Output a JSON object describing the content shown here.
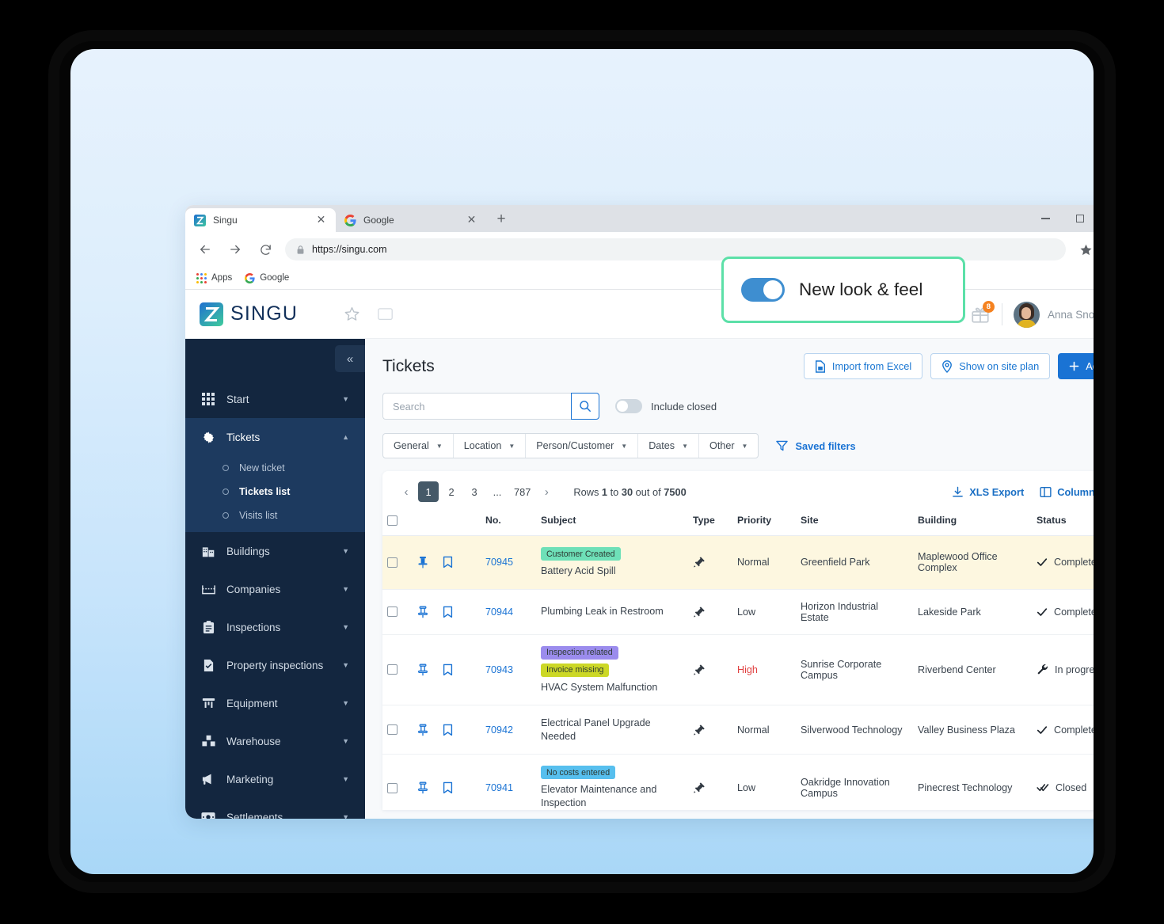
{
  "browser": {
    "tabs": [
      {
        "title": "Singu",
        "favicon": "singu-logo-icon",
        "active": true
      },
      {
        "title": "Google",
        "favicon": "google-g-icon",
        "active": false
      }
    ],
    "new_tab_label": "+",
    "url": "https://singu.com",
    "bookmarks": [
      {
        "label": "Apps",
        "icon": "apps-grid-icon"
      },
      {
        "label": "Google",
        "icon": "google-g-icon"
      }
    ],
    "window_controls": [
      "minimize",
      "maximize",
      "close"
    ]
  },
  "header": {
    "brand": "SINGU",
    "icons": [
      "star-outline-icon",
      "note-icon"
    ],
    "promo": {
      "label": "New look & feel",
      "toggle_on": true,
      "highlight_color": "#5ce0a8",
      "switch_color": "#3e8ed0"
    },
    "gift": {
      "icon": "gift-icon",
      "badge": "8",
      "badge_color": "#f58220"
    },
    "user": {
      "name": "Anna Snow",
      "avatar": "user-avatar",
      "chevron": "chevron-down-icon"
    }
  },
  "sidebar": {
    "collapse_icon": "double-chevron-left-icon",
    "items": [
      {
        "label": "Start",
        "icon": "grid-icon",
        "active": false,
        "expandable": true
      },
      {
        "label": "Tickets",
        "icon": "gear-icon",
        "active": true,
        "expandable": true,
        "expanded": true
      },
      {
        "label": "Buildings",
        "icon": "building-icon",
        "active": false,
        "expandable": true
      },
      {
        "label": "Companies",
        "icon": "companies-icon",
        "active": false,
        "expandable": true
      },
      {
        "label": "Inspections",
        "icon": "clipboard-icon",
        "active": false,
        "expandable": true
      },
      {
        "label": "Property inspections",
        "icon": "document-check-icon",
        "active": false,
        "expandable": true
      },
      {
        "label": "Equipment",
        "icon": "equipment-icon",
        "active": false,
        "expandable": true
      },
      {
        "label": "Warehouse",
        "icon": "warehouse-icon",
        "active": false,
        "expandable": true
      },
      {
        "label": "Marketing",
        "icon": "megaphone-icon",
        "active": false,
        "expandable": true
      },
      {
        "label": "Settlements",
        "icon": "money-icon",
        "active": false,
        "expandable": true
      }
    ],
    "tickets_sub": [
      {
        "label": "New ticket",
        "current": false
      },
      {
        "label": "Tickets list",
        "current": true
      },
      {
        "label": "Visits list",
        "current": false
      }
    ]
  },
  "main": {
    "title": "Tickets",
    "actions": [
      {
        "label": "Import from Excel",
        "icon": "excel-file-icon",
        "style": "outline"
      },
      {
        "label": "Show on site plan",
        "icon": "map-pin-icon",
        "style": "outline"
      },
      {
        "label": "Add",
        "icon": "plus-icon",
        "style": "primary"
      }
    ],
    "search": {
      "value": "",
      "placeholder": "Search",
      "button_icon": "search-icon"
    },
    "include_closed": {
      "label": "Include closed",
      "on": false
    },
    "filters": [
      {
        "label": "General"
      },
      {
        "label": "Location"
      },
      {
        "label": "Person/Customer"
      },
      {
        "label": "Dates"
      },
      {
        "label": "Other"
      }
    ],
    "saved_filters": {
      "label": "Saved filters",
      "icon": "filter-icon"
    },
    "pagination": {
      "prev_icon": "chevron-left-icon",
      "next_icon": "chevron-right-icon",
      "pages": [
        "1",
        "2",
        "3",
        "...",
        "787"
      ],
      "current": "1",
      "rows_prefix": "Rows",
      "rows_from": "1",
      "rows_mid": "to",
      "rows_to": "30",
      "rows_suffix": "out of",
      "rows_total": "7500"
    },
    "table_tools": [
      {
        "label": "XLS Export",
        "icon": "download-icon"
      },
      {
        "label": "Columns",
        "icon": "columns-icon"
      }
    ],
    "table": {
      "columns": [
        "",
        "",
        "No.",
        "Subject",
        "Type",
        "Priority",
        "Site",
        "Building",
        "Status",
        ""
      ],
      "rows": [
        {
          "no": "70945",
          "badges": [
            {
              "text": "Customer Created",
              "color": "#6ee0b8"
            }
          ],
          "subject": "Battery Acid Spill",
          "type_icon": "wrench-hammer-icon",
          "priority": "Normal",
          "priority_level": "normal",
          "site": "Greenfield Park",
          "building": "Maplewood Office Complex",
          "status": "Completed",
          "status_icon": "check-icon",
          "pinned": true,
          "highlight": true
        },
        {
          "no": "70944",
          "badges": [],
          "subject": "Plumbing Leak in Restroom",
          "type_icon": "wrench-hammer-icon",
          "priority": "Low",
          "priority_level": "low",
          "site": "Horizon Industrial Estate",
          "building": "Lakeside Park",
          "status": "Completed",
          "status_icon": "check-icon",
          "pinned": false,
          "highlight": false
        },
        {
          "no": "70943",
          "badges": [
            {
              "text": "Inspection related",
              "color": "#9b8ced"
            },
            {
              "text": "Invoice missing",
              "color": "#ccd827"
            }
          ],
          "subject": "HVAC System Malfunction",
          "type_icon": "wrench-hammer-icon",
          "priority": "High",
          "priority_level": "high",
          "site": "Sunrise Corporate Campus",
          "building": "Riverbend Center",
          "status": "In progress",
          "status_icon": "wrench-icon",
          "pinned": false,
          "highlight": false
        },
        {
          "no": "70942",
          "badges": [],
          "subject": "Electrical Panel Upgrade Needed",
          "type_icon": "wrench-hammer-icon",
          "priority": "Normal",
          "priority_level": "normal",
          "site": "Silverwood Technology",
          "building": "Valley Business Plaza",
          "status": "Completed",
          "status_icon": "check-icon",
          "pinned": false,
          "highlight": false
        },
        {
          "no": "70941",
          "badges": [
            {
              "text": "No costs entered",
              "color": "#57bfee"
            }
          ],
          "subject": "Elevator Maintenance and Inspection",
          "type_icon": "wrench-hammer-icon",
          "priority": "Low",
          "priority_level": "low",
          "site": "Oakridge Innovation Campus",
          "building": "Pinecrest Technology",
          "status": "Closed",
          "status_icon": "double-check-icon",
          "pinned": false,
          "highlight": false
        }
      ]
    }
  }
}
